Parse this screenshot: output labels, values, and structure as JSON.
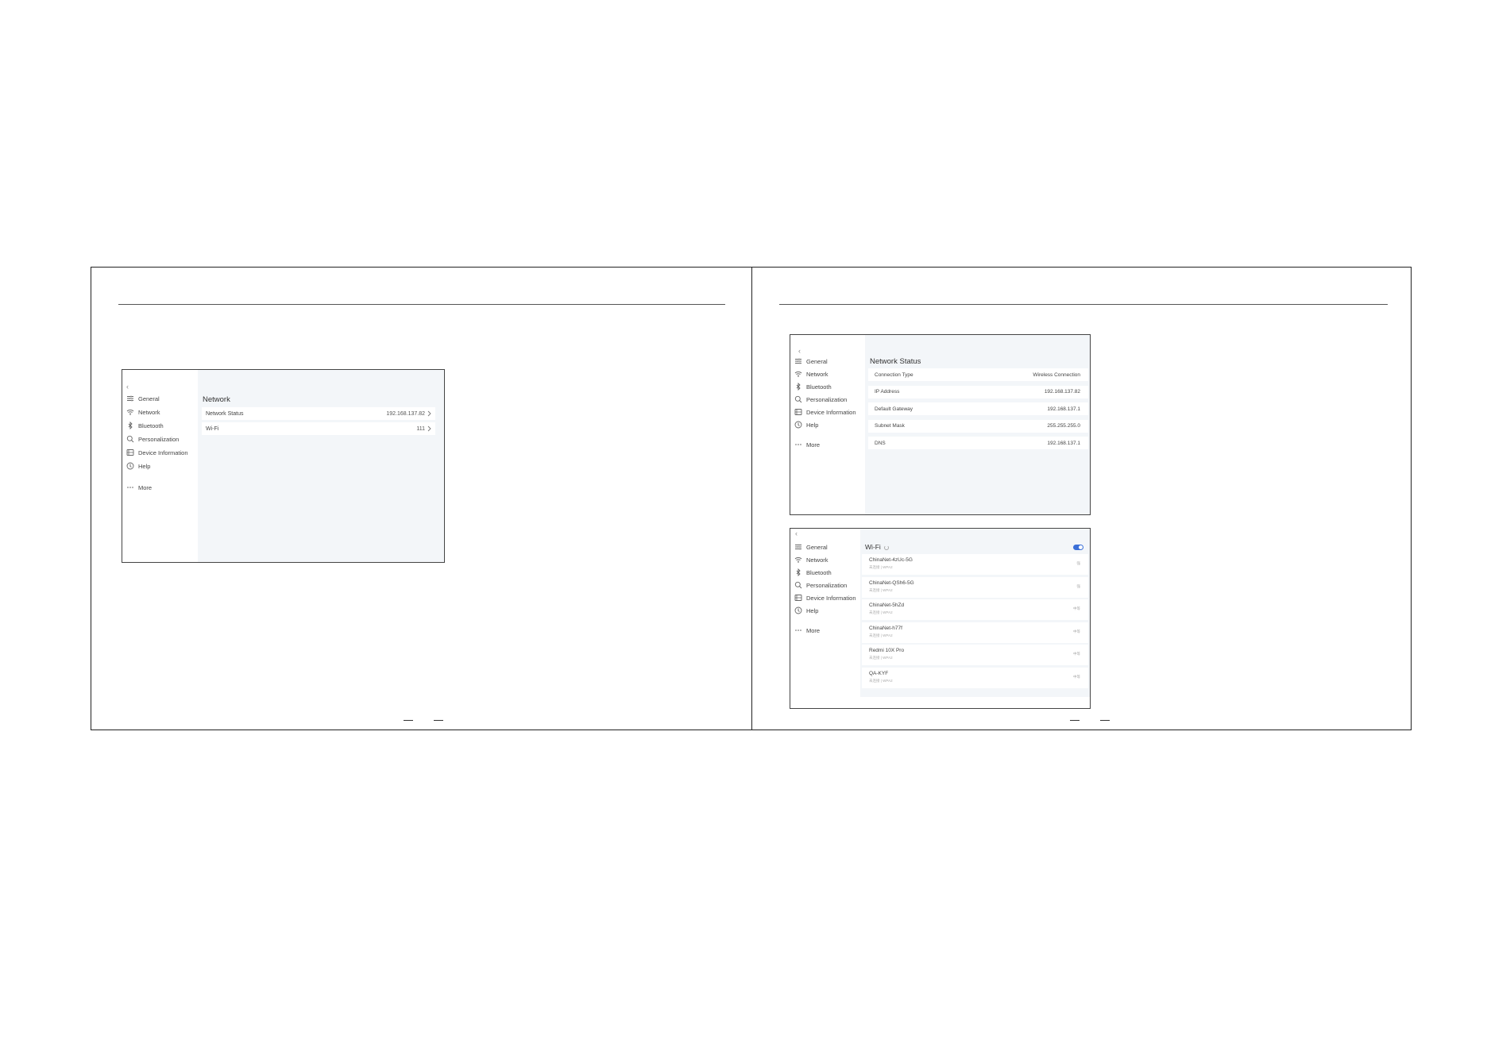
{
  "nav_items": [
    {
      "label": "General",
      "icon": "sliders-icon"
    },
    {
      "label": "Network",
      "icon": "wifi-icon"
    },
    {
      "label": "Bluetooth",
      "icon": "bluetooth-icon"
    },
    {
      "label": "Personalization",
      "icon": "search-icon"
    },
    {
      "label": "Device Information",
      "icon": "device-info-icon"
    },
    {
      "label": "Help",
      "icon": "help-icon"
    },
    {
      "label": "More",
      "icon": "more-icon"
    }
  ],
  "back_glyph": "‹",
  "screen_network": {
    "title": "Network",
    "rows": [
      {
        "label": "Network Status",
        "value": "192.168.137.82"
      },
      {
        "label": "Wi-Fi",
        "value": "111"
      }
    ]
  },
  "screen_status": {
    "title": "Network Status",
    "rows": [
      {
        "label": "Connection Type",
        "value": "Wireless Connection"
      },
      {
        "label": "IP Address",
        "value": "192.168.137.82"
      },
      {
        "label": "Default Gateway",
        "value": "192.168.137.1"
      },
      {
        "label": "Subnet Mask",
        "value": "255.255.255.0"
      },
      {
        "label": "DNS",
        "value": "192.168.137.1"
      }
    ]
  },
  "screen_wifi": {
    "title": "Wi-Fi",
    "toggle_on": true,
    "accent": "#3b6fd8",
    "networks": [
      {
        "name": "ChinaNet-4zUc-5G",
        "sub": "未连接 | WPA2",
        "signal": "强"
      },
      {
        "name": "ChinaNet-QSh6-5G",
        "sub": "未连接 | WPA2",
        "signal": "强"
      },
      {
        "name": "ChinaNet-5hZd",
        "sub": "未连接 | WPA2",
        "signal": "中等"
      },
      {
        "name": "ChinaNet-h77f",
        "sub": "未连接 | WPA2",
        "signal": "中等"
      },
      {
        "name": "Redmi 10X Pro",
        "sub": "未连接 | WPA2",
        "signal": "中等"
      },
      {
        "name": "QA-KYF",
        "sub": "未连接 | WPA2",
        "signal": "中等"
      }
    ]
  }
}
